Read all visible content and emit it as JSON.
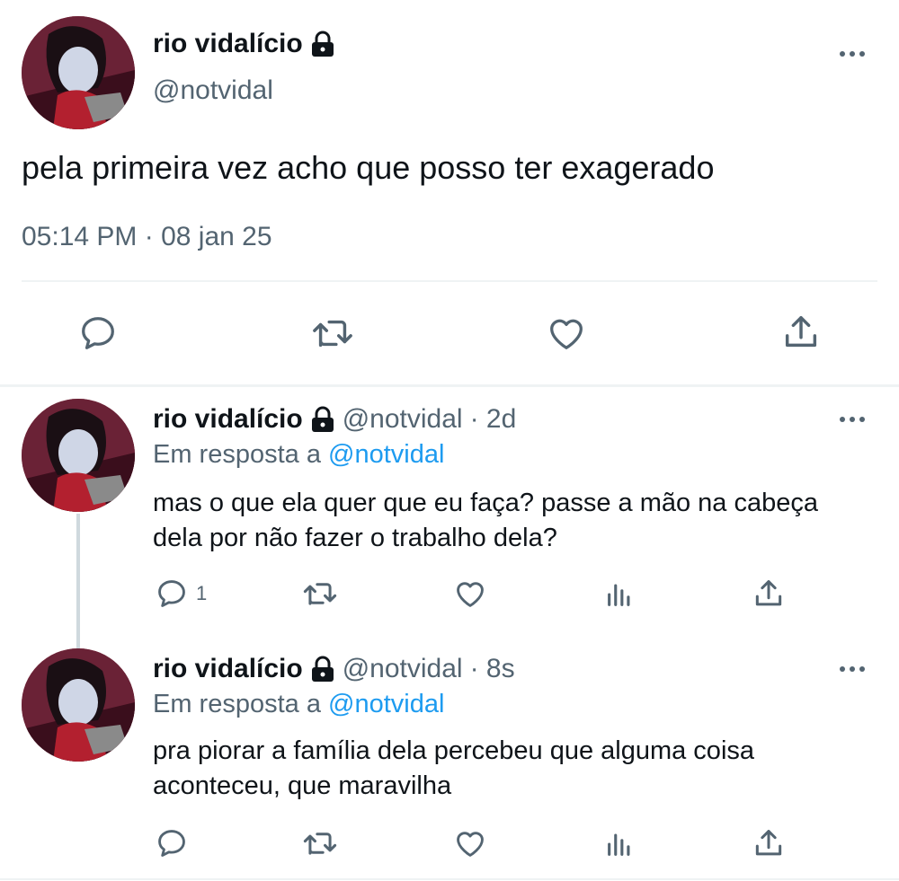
{
  "main_tweet": {
    "name": "rio vidalício",
    "handle": "@notvidal",
    "text": "pela primeira vez acho que posso ter exagerado",
    "meta": "05:14 PM · 08 jan 25"
  },
  "replies": [
    {
      "name": "rio vidalício",
      "handle": "@notvidal",
      "time": "· 2d",
      "reply_prefix": "Em resposta a",
      "reply_to": "@notvidal",
      "text_line1": "mas o que ela quer que eu faça? passe a mão na cabeça",
      "text_line2": "dela por não fazer o trabalho dela?",
      "reply_count": "1"
    },
    {
      "name": "rio vidalício",
      "handle": "@notvidal",
      "time": "· 8s",
      "reply_prefix": "Em resposta a",
      "reply_to": "@notvidal",
      "text_line1": "pra piorar a família dela percebeu que alguma coisa",
      "text_line2": "aconteceu, que maravilha"
    }
  ],
  "icons": {
    "lock": "lock-icon",
    "more": "more-icon",
    "reply": "reply-icon",
    "retweet": "retweet-icon",
    "like": "like-icon",
    "views": "views-icon",
    "share": "share-icon"
  },
  "colors": {
    "text": "#0f1419",
    "secondary": "#536471",
    "link": "#1d9bf0",
    "divider": "#eff3f4"
  }
}
